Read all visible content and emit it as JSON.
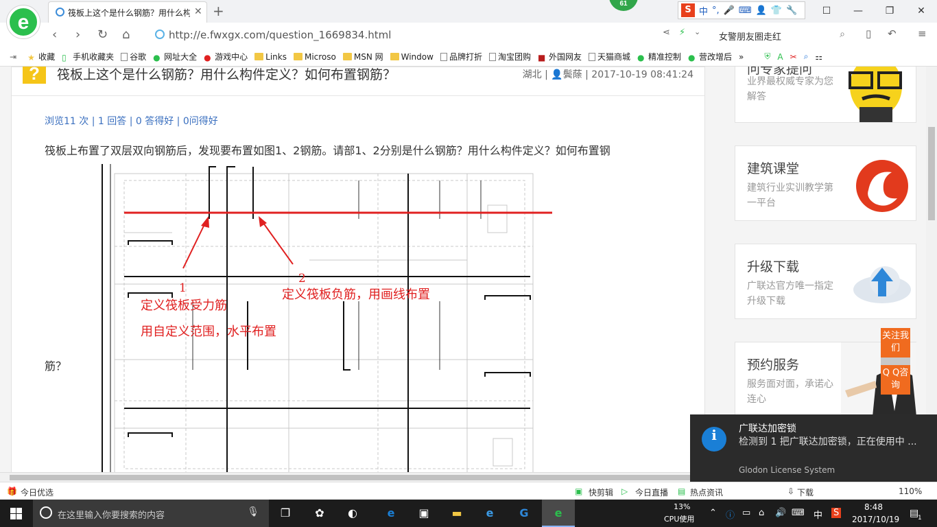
{
  "browser": {
    "tab_title": "筏板上这个是什么钢筋？用什么构",
    "badge_count": "61",
    "url": "http://e.fwxgx.com/question_1669834.html",
    "search_text": "女警朋友圈走红",
    "ime": {
      "s": "S",
      "mode": "中",
      "punct": "°,"
    }
  },
  "bookmarks": [
    "收藏",
    "手机收藏夹",
    "谷歌",
    "网址大全",
    "游戏中心",
    "Links",
    "Microso",
    "MSN 网",
    "Window",
    "品牌打折",
    "淘宝团购",
    "外国网友",
    "天猫商城",
    "精准控制",
    "营改增后"
  ],
  "question": {
    "title": "筏板上这个是什么钢筋？用什么构件定义？如何布置钢筋？",
    "meta": "湖北 | 👤鬓蒢 | 2017-10-19 08:41:24",
    "stats": "浏览11 次 | 1 回答 | 0 答得好 | 0问得好",
    "body_line1": "筏板上布置了双层双向钢筋后，发现要布置如图1、2钢筋。请部1、2分别是什么钢筋？用什么构件定义？如何布置钢",
    "body_line2": "筋？"
  },
  "drawing_annotations": {
    "label1": "1",
    "label2": "2",
    "note1a": "定义筏板受力筋",
    "note1b": "用自定义范围，水平布置",
    "note2": "定义筏板负筋，用画线布置"
  },
  "sidebar": {
    "expert_heading": "问专家提问",
    "expert_desc": "业界最权威专家为您解答",
    "class_heading": "建筑课堂",
    "class_desc": "建筑行业实训教学第一平台",
    "upgrade_heading": "升级下载",
    "upgrade_desc": "广联达官方唯一指定升级下载",
    "booking_heading": "预约服务",
    "booking_desc": "服务面对面，承诺心连心",
    "follow_btn": "关注我们",
    "qq_btn": "Q Q咨询"
  },
  "notification": {
    "title": "广联达加密锁",
    "message": "检测到 1 把广联达加密锁，正在使用中 ...",
    "source": "Glodon License System"
  },
  "statusbar": {
    "today": "今日优选",
    "kuaijianji": "快剪辑",
    "live": "今日直播",
    "news": "热点资讯",
    "download": "下载",
    "zoom": "110%"
  },
  "taskbar": {
    "search_placeholder": "在这里输入你要搜索的内容",
    "cpu_pct": "13%",
    "cpu_label": "CPU使用",
    "ime": "中",
    "time": "8:48",
    "date": "2017/10/19",
    "notif_count": "1"
  },
  "colors": {
    "accent_red": "#e02020",
    "brand_green": "#2bbf4d",
    "float_orange": "#f06b1f"
  }
}
